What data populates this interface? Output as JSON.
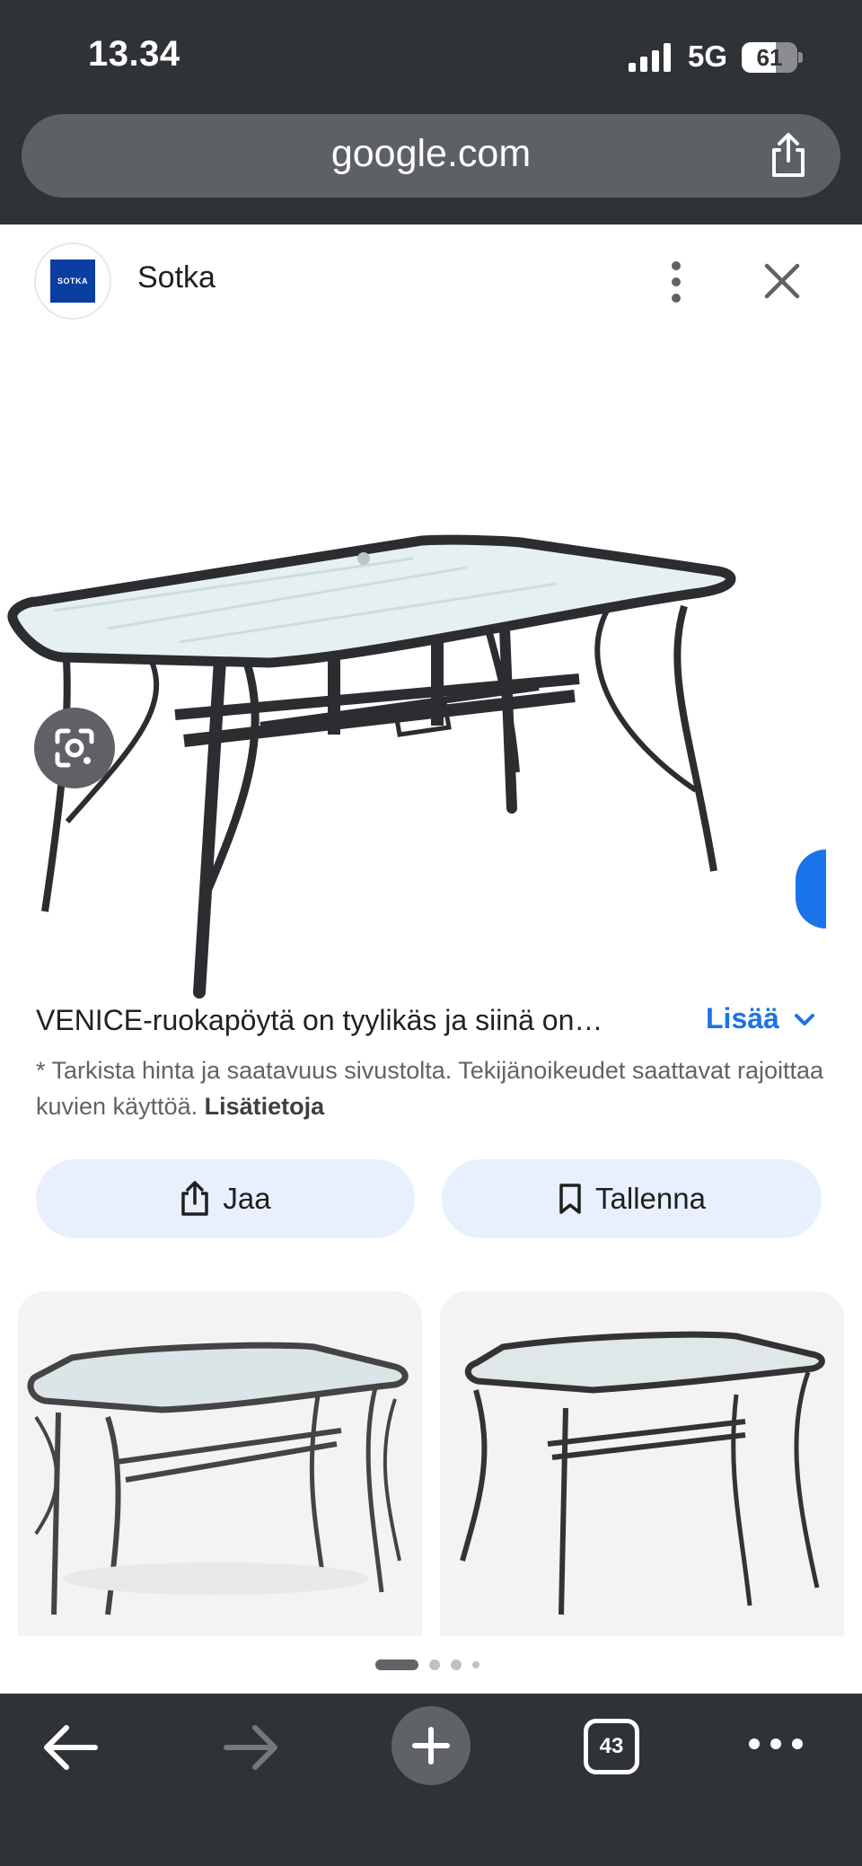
{
  "status_bar": {
    "time": "13.34",
    "network": "5G",
    "battery": "61"
  },
  "browser": {
    "url": "google.com"
  },
  "source": {
    "logo_text": "SOTKA",
    "name": "Sotka"
  },
  "description": {
    "text": "VENICE-ruokapöytä on tyylikäs ja siinä on…",
    "more_label": "Lisää",
    "note": "* Tarkista hinta ja saatavuus sivustolta. Tekijänoikeudet saattavat rajoittaa kuvien käyttöä.",
    "note_link": "Lisätietoja"
  },
  "actions": {
    "share_label": "Jaa",
    "save_label": "Tallenna"
  },
  "pager": {
    "pages": 4,
    "current": 1
  },
  "toolbar": {
    "tab_count": "43"
  },
  "colors": {
    "chrome": "#2f3236",
    "accent": "#1a73e8",
    "pill": "#e8f0fe",
    "brand": "#0b3ea0"
  }
}
